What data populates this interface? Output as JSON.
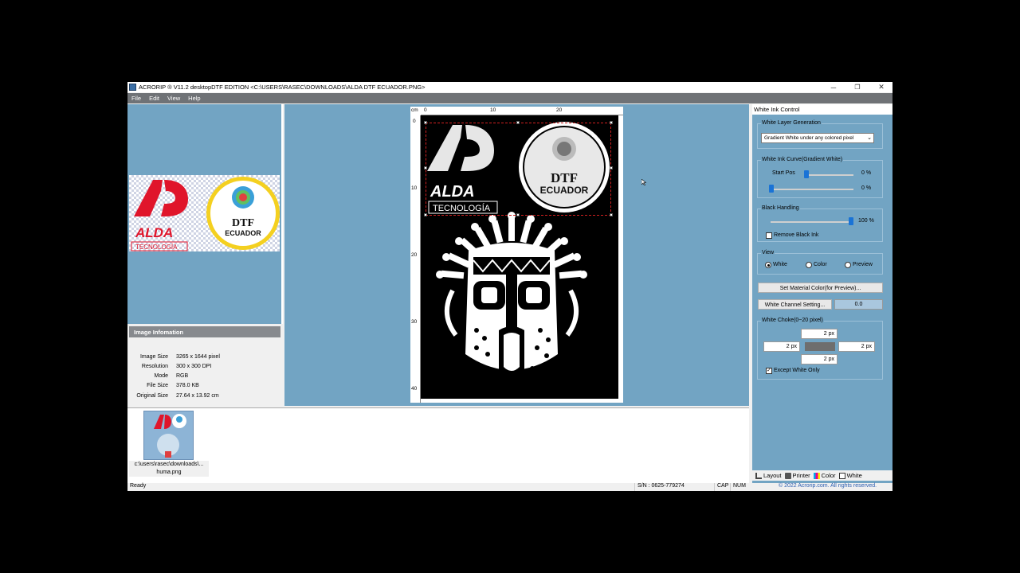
{
  "window": {
    "title": "ACRORIP ® V11.2 desktopDTF EDITION <C:\\USERS\\RASEC\\DOWNLOADS\\ALDA DTF ECUADOR.PNG>",
    "minimize": "─",
    "maximize": "❐",
    "close": "✕"
  },
  "menu": [
    "File",
    "Edit",
    "View",
    "Help"
  ],
  "image_info": {
    "header": "Image Infomation",
    "rows": [
      {
        "label": "Image Size",
        "value": "3265 x 1644 pixel"
      },
      {
        "label": "Resolution",
        "value": "300 x 300 DPI"
      },
      {
        "label": "Mode",
        "value": "RGB"
      },
      {
        "label": "File Size",
        "value": "378.0 KB"
      },
      {
        "label": "Original Size",
        "value": "27.64 x 13.92 cm"
      }
    ]
  },
  "ruler": {
    "unit": "cm",
    "top_ticks": [
      "0",
      "10",
      "20"
    ],
    "left_ticks": [
      "0",
      "10",
      "20",
      "30",
      "40"
    ]
  },
  "artwork": {
    "logo_letters": "AD",
    "logo_name": "ALDA",
    "logo_sub": "TECNOLOGÍA",
    "seal_line1": "DTF",
    "seal_line2": "ECUADOR"
  },
  "thumbnail": {
    "caption_line1": "c:\\users\\rasec\\downloads\\...",
    "caption_line2": "huma.png"
  },
  "white_ink": {
    "panel_title": "White Ink Control",
    "layer_group": "White Layer Generation",
    "layer_select": "Gradient White under any colored pixel",
    "curve_group": "White Ink Curve(Gradient White)",
    "start_pos_label": "Start Pos",
    "start_pos_value": "0 %",
    "start_pos_level": 0,
    "second_value": "0 %",
    "second_level": 0,
    "black_group": "Black Handling",
    "black_value": "100 %",
    "black_level": 100,
    "remove_black": "Remove Black Ink",
    "view_group": "View",
    "view_options": [
      "White",
      "Color",
      "Preview"
    ],
    "view_selected": "White",
    "material_btn": "Set Material Color(for Preview)...",
    "channel_btn": "White Channel Setting...",
    "channel_value": "0.0",
    "choke_group": "White Choke(0~20 pixel)",
    "choke_top": "2 px",
    "choke_left": "2 px",
    "choke_right": "2 px",
    "choke_bottom": "2 px",
    "except_white": "Except White Only"
  },
  "tabs": [
    "Layout",
    "Printer",
    "Color",
    "White"
  ],
  "status": {
    "ready": "Ready",
    "serial": "S/N : 0625-779274",
    "cap": "CAP",
    "num": "NUM",
    "copyright": "© 2022 Acrorip.com. All rights reserved."
  },
  "colors": {
    "panel_blue": "#72a4c3",
    "menu_gray": "#6f7276",
    "accent_blue": "#1a73d6",
    "logo_red": "#e0152b"
  },
  "icons": [
    "app-icon",
    "layout-icon",
    "printer-icon",
    "color-icon",
    "white-icon",
    "checkmark-icon",
    "chevron-down-icon",
    "mouse-cursor-icon"
  ]
}
